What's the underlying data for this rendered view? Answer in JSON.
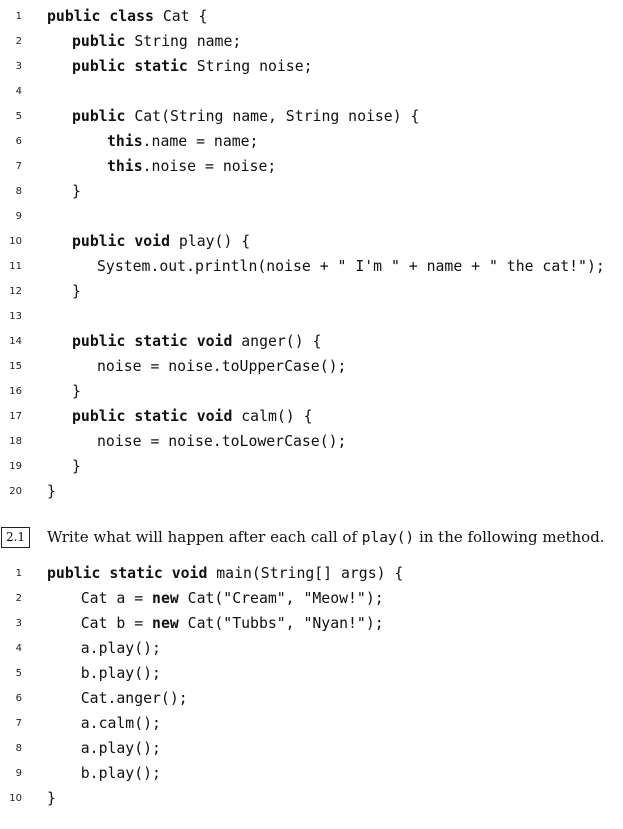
{
  "class_code": [
    {
      "n": "1",
      "indent": 0,
      "parts": [
        {
          "t": "public class",
          "kw": true
        },
        {
          "t": " Cat {"
        }
      ]
    },
    {
      "n": "2",
      "indent": 1,
      "parts": [
        {
          "t": "public",
          "kw": true
        },
        {
          "t": " String name;"
        }
      ]
    },
    {
      "n": "3",
      "indent": 1,
      "parts": [
        {
          "t": "public static",
          "kw": true
        },
        {
          "t": " String noise;"
        }
      ]
    },
    {
      "n": "4",
      "indent": 0,
      "parts": []
    },
    {
      "n": "5",
      "indent": 1,
      "parts": [
        {
          "t": "public",
          "kw": true
        },
        {
          "t": " Cat(String name, String noise) {"
        }
      ]
    },
    {
      "n": "6",
      "indent": 2.4,
      "parts": [
        {
          "t": "this",
          "kw": true
        },
        {
          "t": ".name = name;"
        }
      ]
    },
    {
      "n": "7",
      "indent": 2.4,
      "parts": [
        {
          "t": "this",
          "kw": true
        },
        {
          "t": ".noise = noise;"
        }
      ]
    },
    {
      "n": "8",
      "indent": 1,
      "parts": [
        {
          "t": "}"
        }
      ]
    },
    {
      "n": "9",
      "indent": 0,
      "parts": []
    },
    {
      "n": "10",
      "indent": 1,
      "parts": [
        {
          "t": "public void",
          "kw": true
        },
        {
          "t": " play() {"
        }
      ]
    },
    {
      "n": "11",
      "indent": 2,
      "parts": [
        {
          "t": "System.out.println(noise + \" I'm \" + name + \" the cat!\");"
        }
      ]
    },
    {
      "n": "12",
      "indent": 1,
      "parts": [
        {
          "t": "}"
        }
      ]
    },
    {
      "n": "13",
      "indent": 0,
      "parts": []
    },
    {
      "n": "14",
      "indent": 1,
      "parts": [
        {
          "t": "public static void",
          "kw": true
        },
        {
          "t": " anger() {"
        }
      ]
    },
    {
      "n": "15",
      "indent": 2,
      "parts": [
        {
          "t": "noise = noise.toUpperCase();"
        }
      ]
    },
    {
      "n": "16",
      "indent": 1,
      "parts": [
        {
          "t": "}"
        }
      ]
    },
    {
      "n": "17",
      "indent": 1,
      "parts": [
        {
          "t": "public static void",
          "kw": true
        },
        {
          "t": " calm() {"
        }
      ]
    },
    {
      "n": "18",
      "indent": 2,
      "parts": [
        {
          "t": "noise = noise.toLowerCase();"
        }
      ]
    },
    {
      "n": "19",
      "indent": 1,
      "parts": [
        {
          "t": "}"
        }
      ]
    },
    {
      "n": "20",
      "indent": 0,
      "parts": [
        {
          "t": "}"
        }
      ]
    }
  ],
  "question": {
    "number": "2.1",
    "text_before": "Write what will happen after each call of ",
    "code": "play()",
    "text_after": " in the following method."
  },
  "main_code": [
    {
      "n": "1",
      "indent": 0,
      "parts": [
        {
          "t": "public static void",
          "kw": true
        },
        {
          "t": " main(String[] args) {"
        }
      ]
    },
    {
      "n": "2",
      "indent": 1.35,
      "parts": [
        {
          "t": "Cat a = "
        },
        {
          "t": "new",
          "kw": true
        },
        {
          "t": " Cat(\"Cream\", \"Meow!\");"
        }
      ]
    },
    {
      "n": "3",
      "indent": 1.35,
      "parts": [
        {
          "t": "Cat b = "
        },
        {
          "t": "new",
          "kw": true
        },
        {
          "t": " Cat(\"Tubbs\", \"Nyan!\");"
        }
      ]
    },
    {
      "n": "4",
      "indent": 1.35,
      "parts": [
        {
          "t": "a.play();"
        }
      ]
    },
    {
      "n": "5",
      "indent": 1.35,
      "parts": [
        {
          "t": "b.play();"
        }
      ]
    },
    {
      "n": "6",
      "indent": 1.35,
      "parts": [
        {
          "t": "Cat.anger();"
        }
      ]
    },
    {
      "n": "7",
      "indent": 1.35,
      "parts": [
        {
          "t": "a.calm();"
        }
      ]
    },
    {
      "n": "8",
      "indent": 1.35,
      "parts": [
        {
          "t": "a.play();"
        }
      ]
    },
    {
      "n": "9",
      "indent": 1.35,
      "parts": [
        {
          "t": "b.play();"
        }
      ]
    },
    {
      "n": "10",
      "indent": 0,
      "parts": [
        {
          "t": "}"
        }
      ]
    }
  ]
}
